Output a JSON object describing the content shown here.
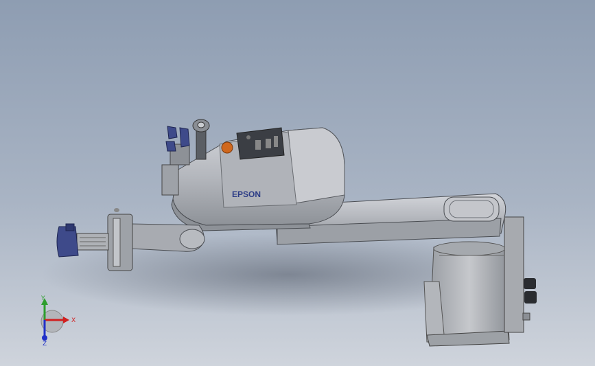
{
  "scene": {
    "brand_label": "EPSON",
    "colors": {
      "background_top": "#8e9db2",
      "background_bottom": "#cfd4dc",
      "arm_body": "#b9bcc2",
      "arm_dark": "#6f737a",
      "gripper_blue": "#3e4a8a",
      "brand_blue": "#2c3c86",
      "estop_orange": "#d0681e"
    }
  },
  "triad": {
    "x_label": "X",
    "y_label": "Y",
    "z_label": "Z",
    "x_color": "#d02020",
    "y_color": "#2e9e2e",
    "z_color": "#2030c8"
  }
}
